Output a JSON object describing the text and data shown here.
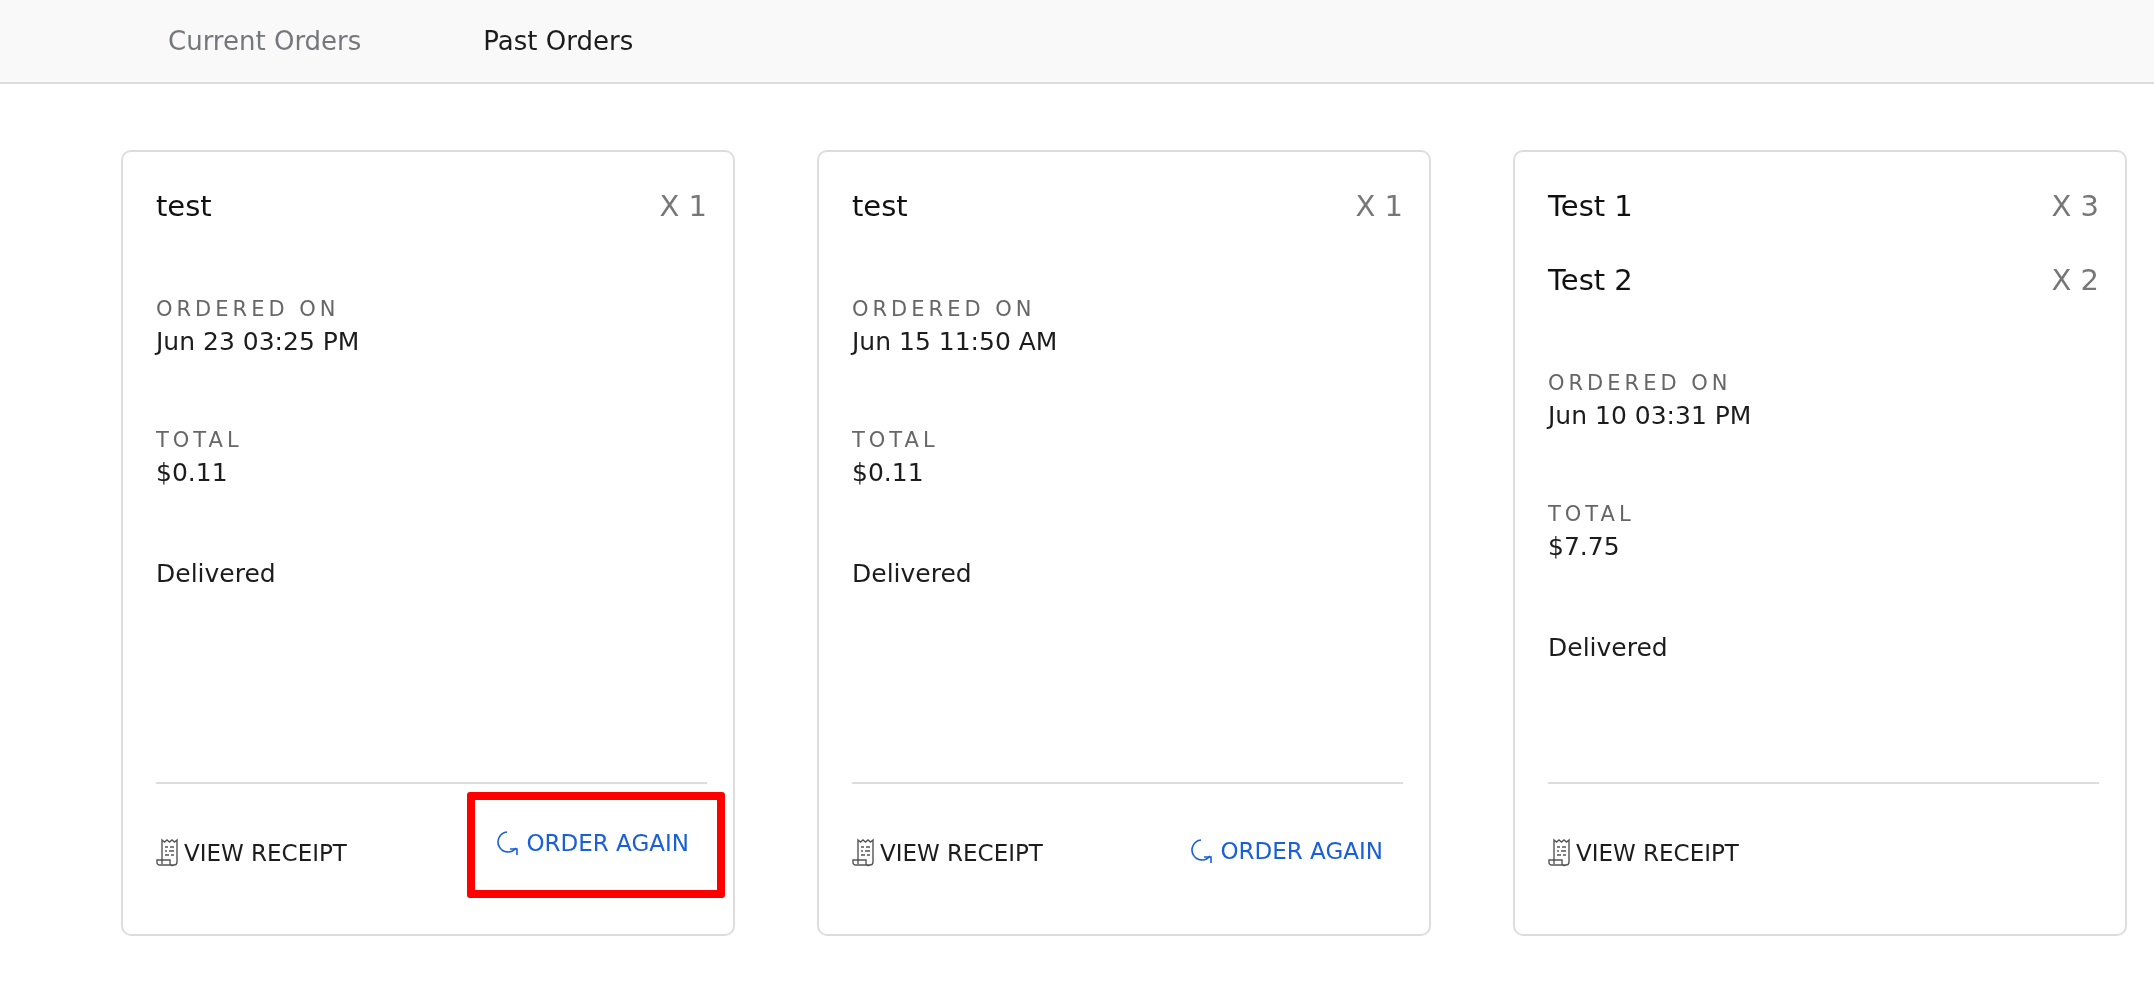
{
  "tabs": [
    {
      "label": "Current Orders",
      "selected": false
    },
    {
      "label": "Past Orders",
      "selected": true
    }
  ],
  "orders": [
    {
      "items": [
        {
          "name": "test",
          "quantity": "X 1"
        }
      ],
      "ordered_on_label": "ORDERED ON",
      "ordered_on": "Jun 23 03:25 PM",
      "total_label": "TOTAL",
      "total": "$0.11",
      "status": "Delivered",
      "actions": [
        {
          "kind": "receipt",
          "label": "VIEW RECEIPT",
          "highlighted": false
        },
        {
          "kind": "reorder",
          "label": "ORDER AGAIN",
          "highlighted": true
        }
      ]
    },
    {
      "items": [
        {
          "name": "test",
          "quantity": "X 1"
        }
      ],
      "ordered_on_label": "ORDERED ON",
      "ordered_on": "Jun 15 11:50 AM",
      "total_label": "TOTAL",
      "total": "$0.11",
      "status": "Delivered",
      "actions": [
        {
          "kind": "receipt",
          "label": "VIEW RECEIPT",
          "highlighted": false
        },
        {
          "kind": "reorder",
          "label": "ORDER AGAIN",
          "highlighted": false
        }
      ]
    },
    {
      "items": [
        {
          "name": "Test 1",
          "quantity": "X 3"
        },
        {
          "name": "Test 2",
          "quantity": "X 2"
        }
      ],
      "ordered_on_label": "ORDERED ON",
      "ordered_on": "Jun 10 03:31 PM",
      "total_label": "TOTAL",
      "total": "$7.75",
      "status": "Delivered",
      "actions": [
        {
          "kind": "receipt",
          "label": "VIEW RECEIPT",
          "highlighted": false
        }
      ]
    }
  ]
}
